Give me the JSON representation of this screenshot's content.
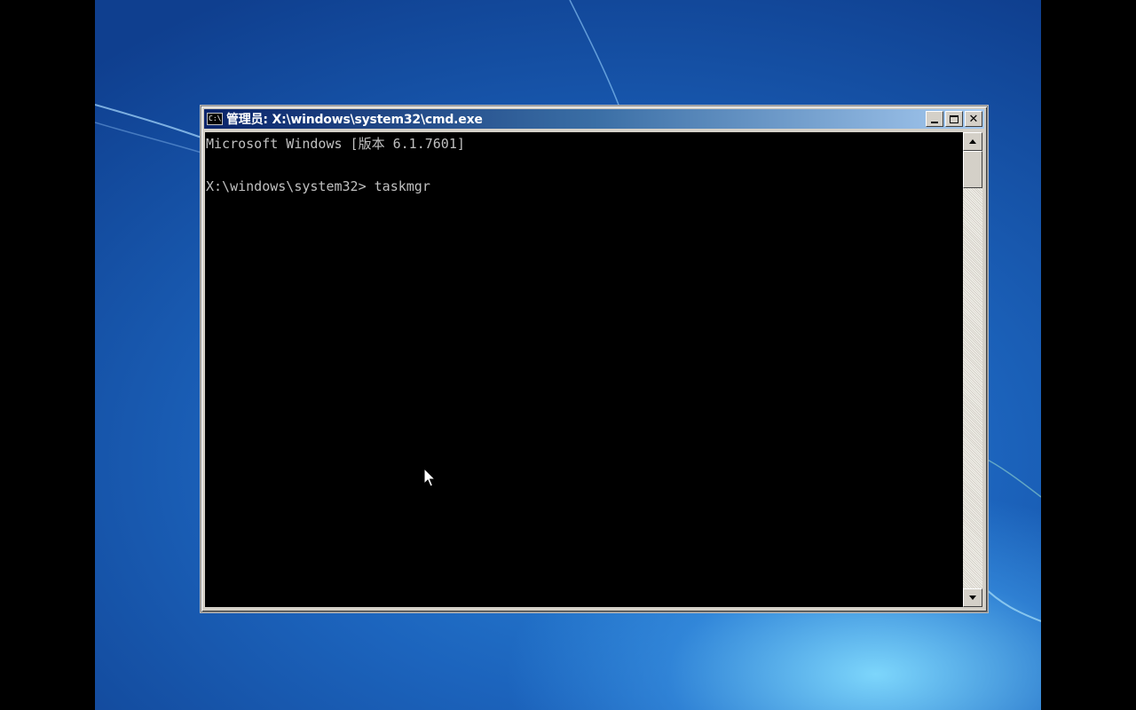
{
  "window": {
    "title": "管理员: X:\\windows\\system32\\cmd.exe",
    "icon": "console-icon",
    "icon_text": "C:\\",
    "buttons": [
      "minimize",
      "maximize",
      "close"
    ],
    "close_glyph": "✕"
  },
  "console": {
    "lines": [
      "Microsoft Windows [版本 6.1.7601]",
      "X:\\windows\\system32> taskmgr"
    ],
    "fg_color": "#c0c0c0",
    "bg_color": "#000000"
  },
  "desktop": {
    "wallpaper": "Windows 7 default blue",
    "colors": {
      "titlebar_start": "#0a246a",
      "titlebar_end": "#a6caf0"
    }
  },
  "pointer": {
    "icon": "arrow-cursor-icon"
  }
}
